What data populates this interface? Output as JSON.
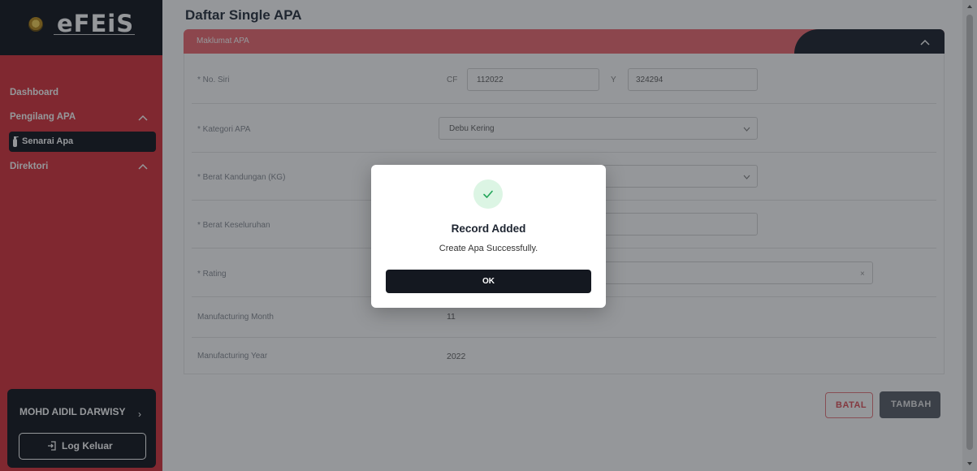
{
  "app": {
    "logo_text": "eFEiS"
  },
  "sidebar": {
    "items": [
      {
        "label": "Dashboard"
      },
      {
        "label": "Pengilang APA"
      },
      {
        "label": "Senarai Apa"
      },
      {
        "label": "Direktori"
      }
    ],
    "user": {
      "name": "MOHD AIDIL DARWISY",
      "chevron": "›"
    },
    "logout_label": "Log Keluar"
  },
  "main": {
    "title": "Daftar Single APA",
    "section_title": "Maklumat APA",
    "fields": {
      "no_siri": {
        "label": "* No. Siri",
        "prefix1": "CF",
        "value1": "112022",
        "prefix2": "Y",
        "value2": "324294"
      },
      "kategori": {
        "label": "* Kategori APA",
        "value": "Debu Kering"
      },
      "berat_kandungan": {
        "label": "* Berat Kandungan (KG)"
      },
      "berat_keseluruhan": {
        "label": "* Berat Keseluruhan"
      },
      "rating": {
        "label": "* Rating",
        "clear": "×"
      },
      "month": {
        "label": "Manufacturing Month",
        "value": "11"
      },
      "year": {
        "label": "Manufacturing Year",
        "value": "2022"
      }
    },
    "buttons": {
      "batal": "BATAL",
      "tambah": "TAMBAH"
    }
  },
  "modal": {
    "title": "Record Added",
    "message": "Create Apa Successfully.",
    "ok_label": "OK",
    "icon": "check-icon",
    "icon_color": "#22a559",
    "icon_bg": "#dcf5e4"
  },
  "colors": {
    "sidebar": "#d9363e",
    "dark": "#141820",
    "accent": "#ef6c73"
  }
}
